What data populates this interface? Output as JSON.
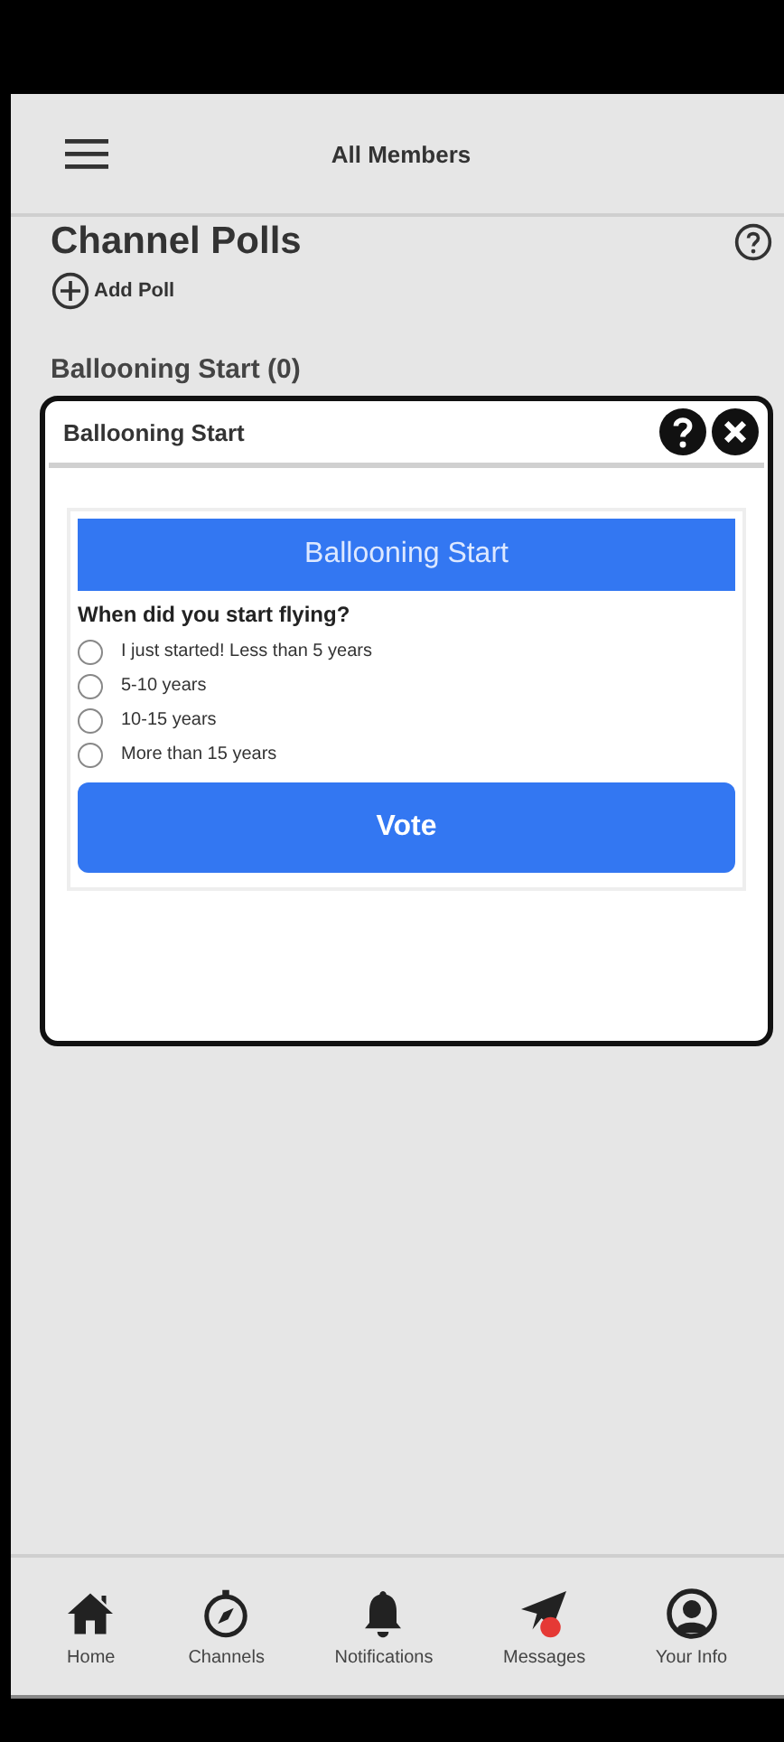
{
  "header": {
    "title": "All Members"
  },
  "page": {
    "title": "Channel Polls",
    "add_label": "Add Poll",
    "poll_heading": "Ballooning Start (0)"
  },
  "dialog": {
    "title": "Ballooning Start",
    "poll_title": "Ballooning Start",
    "question": "When did you start flying?",
    "options": [
      {
        "label": "I just started! Less than 5 years",
        "selected": false
      },
      {
        "label": "5-10 years",
        "selected": false
      },
      {
        "label": "10-15 years",
        "selected": false
      },
      {
        "label": "More than 15 years",
        "selected": false
      }
    ],
    "submit": "Vote"
  },
  "nav": [
    {
      "kind": "home",
      "label": "Home"
    },
    {
      "kind": "channels",
      "label": "Channels"
    },
    {
      "kind": "notifications",
      "label": "Notifications"
    },
    {
      "kind": "messages",
      "label": "Messages"
    },
    {
      "kind": "profile",
      "label": "Your Info"
    }
  ]
}
